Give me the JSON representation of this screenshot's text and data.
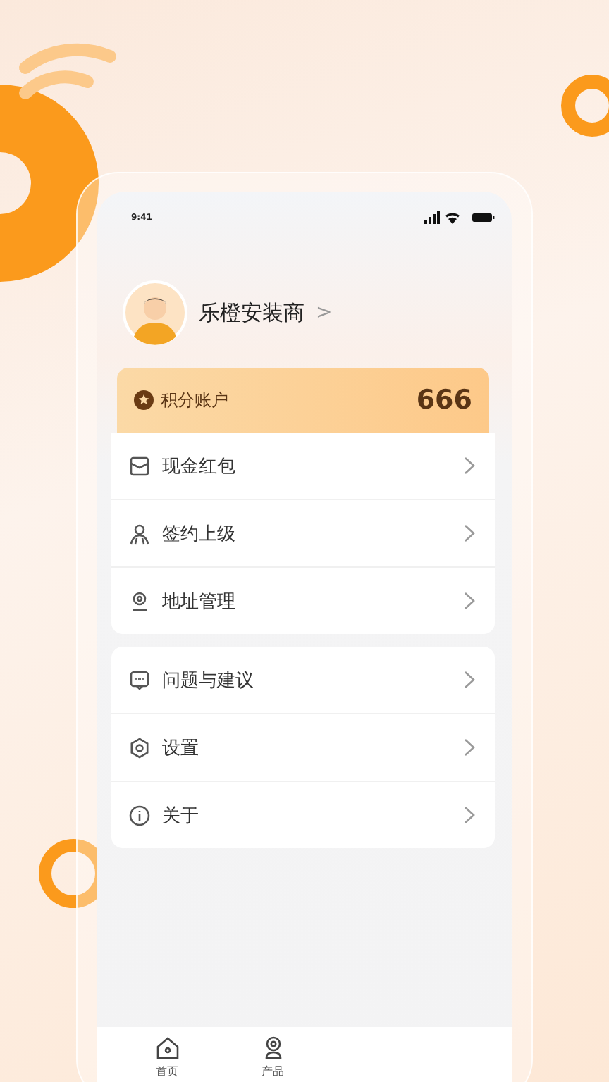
{
  "status_bar": {
    "time": "9:41"
  },
  "profile": {
    "name": "乐橙安装商",
    "chevron": ">"
  },
  "points": {
    "label": "积分账户",
    "value": "666"
  },
  "menu_groups": [
    {
      "items": [
        {
          "kind": "envelope",
          "label": "现金红包"
        },
        {
          "kind": "person",
          "label": "签约上级"
        },
        {
          "kind": "location",
          "label": "地址管理"
        }
      ]
    },
    {
      "items": [
        {
          "kind": "chat",
          "label": "问题与建议"
        },
        {
          "kind": "settings",
          "label": "设置"
        },
        {
          "kind": "info",
          "label": "关于"
        }
      ]
    }
  ],
  "tab_bar": [
    {
      "kind": "home",
      "label": "首页"
    },
    {
      "kind": "camera",
      "label": "产品"
    }
  ]
}
